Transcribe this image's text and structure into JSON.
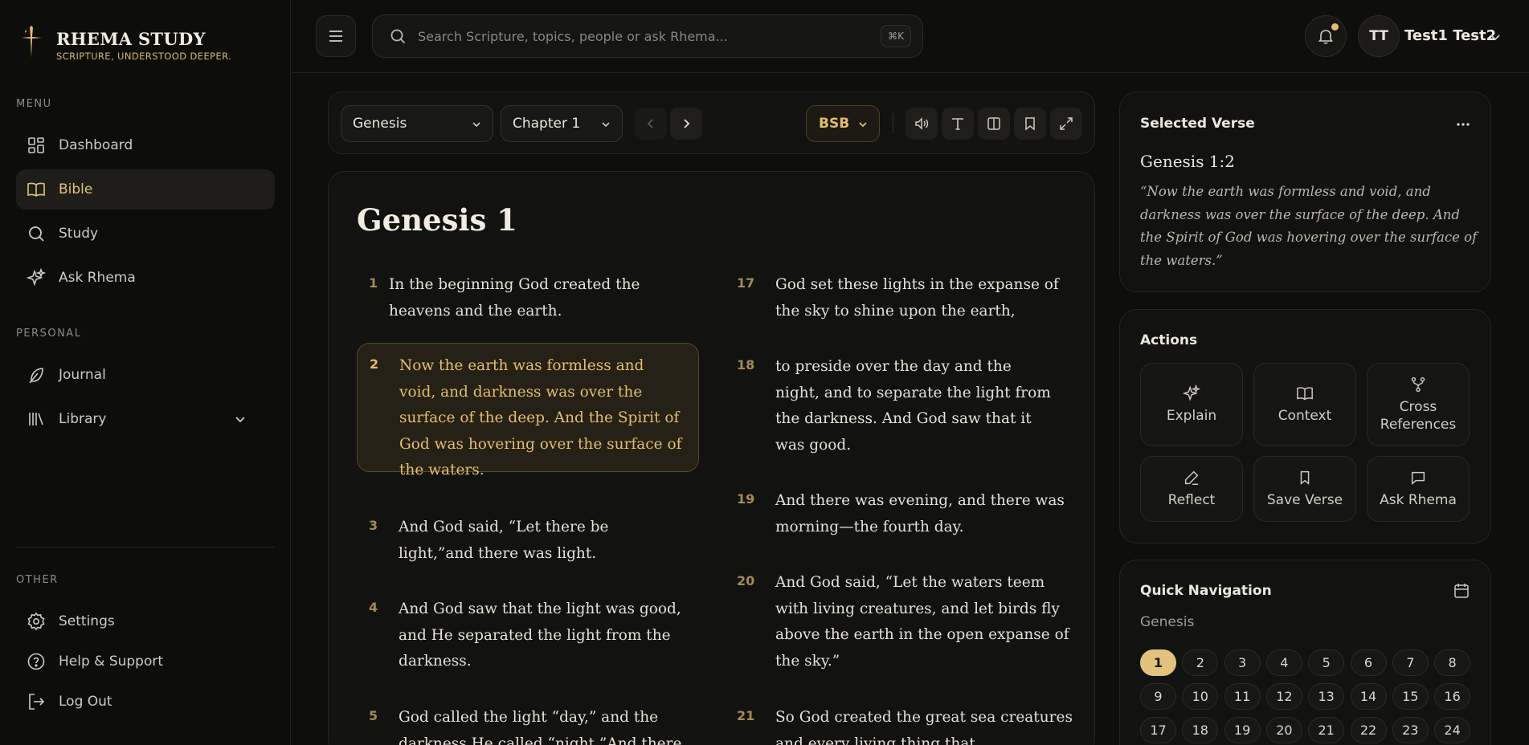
{
  "brand": {
    "title": "RHEMA STUDY",
    "subtitle": "SCRIPTURE, UNDERSTOOD DEEPER."
  },
  "sidebar": {
    "menu_label": "MENU",
    "menu": [
      {
        "label": "Dashboard",
        "icon": "dashboard-icon"
      },
      {
        "label": "Bible",
        "icon": "book-icon",
        "active": true
      },
      {
        "label": "Study",
        "icon": "search-icon"
      },
      {
        "label": "Ask Rhema",
        "icon": "sparkles-icon"
      }
    ],
    "personal_label": "PERSONAL",
    "personal": [
      {
        "label": "Journal",
        "icon": "feather-icon"
      },
      {
        "label": "Library",
        "icon": "library-icon"
      }
    ],
    "other_label": "OTHER",
    "other": [
      {
        "label": "Settings",
        "icon": "gear-icon"
      },
      {
        "label": "Help & Support",
        "icon": "help-icon"
      },
      {
        "label": "Log Out",
        "icon": "logout-icon"
      }
    ]
  },
  "topbar": {
    "search_placeholder": "Search Scripture, topics, people or ask Rhema...",
    "shortcut": "⌘K",
    "user_initials": "TT",
    "user_name": "Test1 Test2"
  },
  "toolbar": {
    "book": "Genesis",
    "chapter": "Chapter 1",
    "translation": "BSB"
  },
  "reader": {
    "title": "Genesis 1",
    "left_verses": [
      {
        "num": "1",
        "text": "In the beginning God created the heavens and the earth."
      },
      {
        "num": "2",
        "text": "Now the earth was formless and void, and darkness was over the surface of the deep. And the Spirit of God was hovering over the surface of the waters."
      },
      {
        "num": "3",
        "text": "And God said, “Let there be light,”and there was light."
      },
      {
        "num": "4",
        "text": "And God saw that the light was good, and He separated the light from the darkness."
      },
      {
        "num": "5",
        "text": "God called the light “day,” and the darkness He called “night.”And there"
      }
    ],
    "right_verses": [
      {
        "num": "17",
        "text": "God set these lights in the expanse of the sky to shine upon the earth,"
      },
      {
        "num": "18",
        "text": "to preside over the day and the night, and to separate the light from the darkness. And God saw that it was good."
      },
      {
        "num": "19",
        "text": "And there was evening, and there was morning—the fourth day."
      },
      {
        "num": "20",
        "text": "And God said, “Let the waters teem with living creatures, and let birds fly above the earth in the open expanse of the sky.”"
      },
      {
        "num": "21",
        "text": "So God created the great sea creatures and every living thing that"
      }
    ]
  },
  "selected_verse": {
    "title": "Selected Verse",
    "reference": "Genesis 1:2",
    "quote": "“Now the earth was formless and void, and darkness was over the surface of the deep. And the Spirit of God was hovering over the surface of the waters.”"
  },
  "actions": {
    "title": "Actions",
    "items": [
      {
        "label": "Explain",
        "icon": "sparkles-icon"
      },
      {
        "label": "Context",
        "icon": "book-open-icon"
      },
      {
        "label": "Cross References",
        "icon": "fork-icon"
      },
      {
        "label": "Reflect",
        "icon": "pen-icon"
      },
      {
        "label": "Save Verse",
        "icon": "bookmark-icon"
      },
      {
        "label": "Ask Rhema",
        "icon": "chat-icon"
      }
    ]
  },
  "quick_nav": {
    "title": "Quick Navigation",
    "book": "Genesis",
    "current": 1,
    "chapters": [
      "1",
      "2",
      "3",
      "4",
      "5",
      "6",
      "7",
      "8",
      "9",
      "10",
      "11",
      "12",
      "13",
      "14",
      "15",
      "16",
      "17",
      "18",
      "19",
      "20",
      "21",
      "22",
      "23",
      "24"
    ]
  },
  "colors": {
    "accent": "#e3c27d",
    "background": "#0e0e0d",
    "panel": "#121211"
  }
}
